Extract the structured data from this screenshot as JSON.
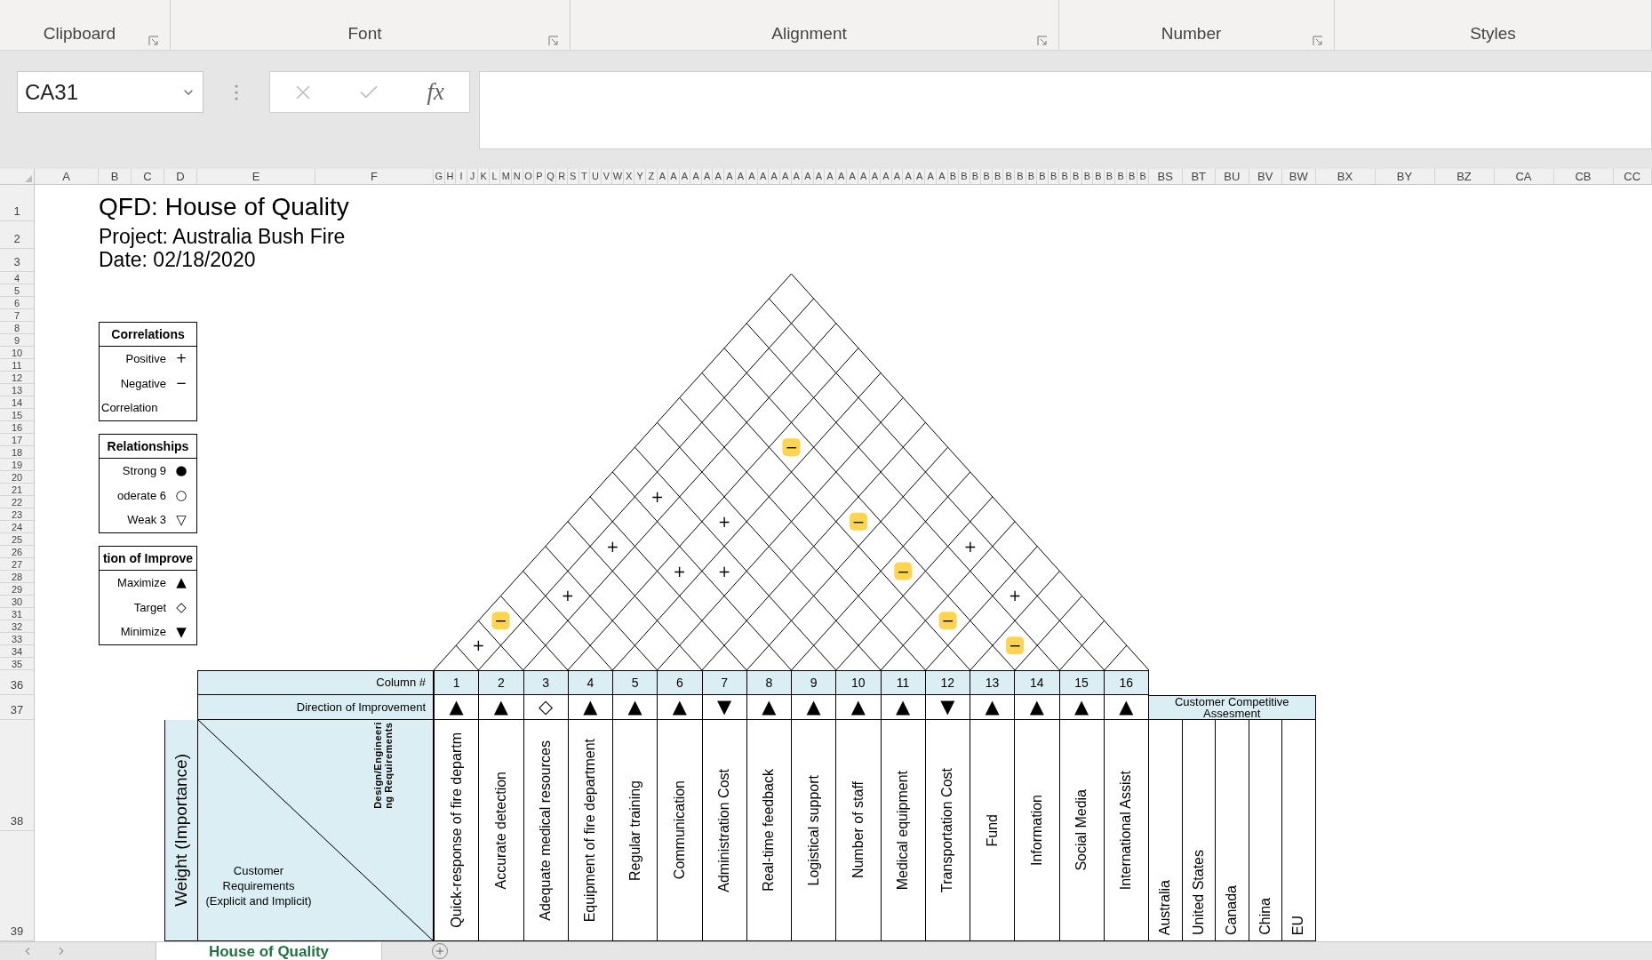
{
  "ribbon_groups": [
    {
      "label": "Clipboard",
      "launcher": true
    },
    {
      "label": "Font",
      "launcher": true
    },
    {
      "label": "Alignment",
      "launcher": true
    },
    {
      "label": "Number",
      "launcher": true
    },
    {
      "label": "Styles",
      "launcher": false
    }
  ],
  "formula_bar": {
    "name_box": "CA31",
    "function_label": "fx"
  },
  "column_headers": [
    {
      "label": "A",
      "kind": "first"
    },
    {
      "label": "B",
      "kind": "medium"
    },
    {
      "label": "C",
      "kind": "medium"
    },
    {
      "label": "D",
      "kind": "medium"
    },
    {
      "label": "E",
      "kind": "wide"
    },
    {
      "label": "F",
      "kind": "wide"
    },
    {
      "label": "G",
      "kind": "narrow"
    },
    {
      "label": "H",
      "kind": "narrow"
    },
    {
      "label": "I",
      "kind": "narrow"
    },
    {
      "label": "J",
      "kind": "narrow"
    },
    {
      "label": "K",
      "kind": "narrow"
    },
    {
      "label": "L",
      "kind": "narrow"
    },
    {
      "label": "M",
      "kind": "narrow"
    },
    {
      "label": "N",
      "kind": "narrow"
    },
    {
      "label": "O",
      "kind": "narrow"
    },
    {
      "label": "P",
      "kind": "narrow"
    },
    {
      "label": "Q",
      "kind": "narrow"
    },
    {
      "label": "R",
      "kind": "narrow"
    },
    {
      "label": "S",
      "kind": "narrow"
    },
    {
      "label": "T",
      "kind": "narrow"
    },
    {
      "label": "U",
      "kind": "narrow"
    },
    {
      "label": "V",
      "kind": "narrow"
    },
    {
      "label": "W",
      "kind": "narrow"
    },
    {
      "label": "X",
      "kind": "narrow"
    },
    {
      "label": "Y",
      "kind": "narrow"
    },
    {
      "label": "Z",
      "kind": "narrow"
    },
    {
      "label": "A",
      "kind": "narrow"
    },
    {
      "label": "A",
      "kind": "narrow"
    },
    {
      "label": "A",
      "kind": "narrow"
    },
    {
      "label": "A",
      "kind": "narrow"
    },
    {
      "label": "A",
      "kind": "narrow"
    },
    {
      "label": "A",
      "kind": "narrow"
    },
    {
      "label": "A",
      "kind": "narrow"
    },
    {
      "label": "A",
      "kind": "narrow"
    },
    {
      "label": "A",
      "kind": "narrow"
    },
    {
      "label": "A",
      "kind": "narrow"
    },
    {
      "label": "A",
      "kind": "narrow"
    },
    {
      "label": "A",
      "kind": "narrow"
    },
    {
      "label": "A",
      "kind": "narrow"
    },
    {
      "label": "A",
      "kind": "narrow"
    },
    {
      "label": "A",
      "kind": "narrow"
    },
    {
      "label": "A",
      "kind": "narrow"
    },
    {
      "label": "A",
      "kind": "narrow"
    },
    {
      "label": "A",
      "kind": "narrow"
    },
    {
      "label": "A",
      "kind": "narrow"
    },
    {
      "label": "A",
      "kind": "narrow"
    },
    {
      "label": "A",
      "kind": "narrow"
    },
    {
      "label": "A",
      "kind": "narrow"
    },
    {
      "label": "A",
      "kind": "narrow"
    },
    {
      "label": "A",
      "kind": "narrow"
    },
    {
      "label": "A",
      "kind": "narrow"
    },
    {
      "label": "A",
      "kind": "narrow"
    },
    {
      "label": "B",
      "kind": "narrow"
    },
    {
      "label": "B",
      "kind": "narrow"
    },
    {
      "label": "B",
      "kind": "narrow"
    },
    {
      "label": "B",
      "kind": "narrow"
    },
    {
      "label": "B",
      "kind": "narrow"
    },
    {
      "label": "B",
      "kind": "narrow"
    },
    {
      "label": "B",
      "kind": "narrow"
    },
    {
      "label": "B",
      "kind": "narrow"
    },
    {
      "label": "B",
      "kind": "narrow"
    },
    {
      "label": "B",
      "kind": "narrow"
    },
    {
      "label": "B",
      "kind": "narrow"
    },
    {
      "label": "B",
      "kind": "narrow"
    },
    {
      "label": "B",
      "kind": "narrow"
    },
    {
      "label": "B",
      "kind": "narrow"
    },
    {
      "label": "B",
      "kind": "narrow"
    },
    {
      "label": "B",
      "kind": "narrow"
    },
    {
      "label": "B",
      "kind": "narrow"
    },
    {
      "label": "B",
      "kind": "narrow"
    },
    {
      "label": "BS",
      "kind": "small"
    },
    {
      "label": "BT",
      "kind": "small"
    },
    {
      "label": "BU",
      "kind": "small"
    },
    {
      "label": "BV",
      "kind": "small"
    },
    {
      "label": "BW",
      "kind": "small"
    },
    {
      "label": "BX",
      "kind": "regular"
    },
    {
      "label": "BY",
      "kind": "regular"
    },
    {
      "label": "BZ",
      "kind": "regular"
    },
    {
      "label": "CA",
      "kind": "regular"
    },
    {
      "label": "CB",
      "kind": "regular"
    },
    {
      "label": "CC",
      "kind": "partial"
    }
  ],
  "row_headers": [
    {
      "label": "1",
      "kind": "title"
    },
    {
      "label": "2",
      "kind": "subtitle"
    },
    {
      "label": "3",
      "kind": "text"
    },
    {
      "label": "4",
      "kind": "thin"
    },
    {
      "label": "5",
      "kind": "thin"
    },
    {
      "label": "6",
      "kind": "thin"
    },
    {
      "label": "7",
      "kind": "thin"
    },
    {
      "label": "8",
      "kind": "thin"
    },
    {
      "label": "9",
      "kind": "thin"
    },
    {
      "label": "10",
      "kind": "thin"
    },
    {
      "label": "11",
      "kind": "thin"
    },
    {
      "label": "12",
      "kind": "thin"
    },
    {
      "label": "13",
      "kind": "thin"
    },
    {
      "label": "14",
      "kind": "thin"
    },
    {
      "label": "15",
      "kind": "thin"
    },
    {
      "label": "16",
      "kind": "thin"
    },
    {
      "label": "17",
      "kind": "thin"
    },
    {
      "label": "18",
      "kind": "thin"
    },
    {
      "label": "19",
      "kind": "thin"
    },
    {
      "label": "20",
      "kind": "thin"
    },
    {
      "label": "21",
      "kind": "thin"
    },
    {
      "label": "22",
      "kind": "thin"
    },
    {
      "label": "23",
      "kind": "thin"
    },
    {
      "label": "24",
      "kind": "thin"
    },
    {
      "label": "25",
      "kind": "thin"
    },
    {
      "label": "26",
      "kind": "thin"
    },
    {
      "label": "27",
      "kind": "thin"
    },
    {
      "label": "28",
      "kind": "thin"
    },
    {
      "label": "29",
      "kind": "thin"
    },
    {
      "label": "30",
      "kind": "thin"
    },
    {
      "label": "31",
      "kind": "thin"
    },
    {
      "label": "32",
      "kind": "thin"
    },
    {
      "label": "33",
      "kind": "thin"
    },
    {
      "label": "34",
      "kind": "thin"
    },
    {
      "label": "35",
      "kind": "thin"
    },
    {
      "label": "36",
      "kind": "header"
    },
    {
      "label": "37",
      "kind": "header"
    },
    {
      "label": "38",
      "kind": "tall"
    },
    {
      "label": "39",
      "kind": "tall"
    }
  ],
  "sheet": {
    "title": "QFD: House of Quality",
    "project": "Project: Australia Bush Fire",
    "date": "Date: 02/18/2020",
    "legends": [
      {
        "title": "Correlations",
        "items": [
          {
            "kind": "entry",
            "label": "Positive",
            "symbol": "+"
          },
          {
            "kind": "entry",
            "label": "Negative",
            "symbol": "−"
          },
          {
            "kind": "note",
            "label": "Correlation"
          }
        ]
      },
      {
        "title": "Relationships",
        "items": [
          {
            "kind": "entry",
            "label": "Strong 9",
            "symbol": "●"
          },
          {
            "kind": "entry",
            "label": "oderate 6",
            "symbol": "○"
          },
          {
            "kind": "entry",
            "label": "Weak 3",
            "symbol": "▽"
          }
        ]
      },
      {
        "title": "tion of Improve",
        "items": [
          {
            "kind": "entry",
            "label": "Maximize",
            "symbol": "▲"
          },
          {
            "kind": "entry",
            "label": "Target",
            "symbol": "◇"
          },
          {
            "kind": "entry",
            "label": "Minimize",
            "symbol": "▼"
          }
        ]
      }
    ],
    "hoq": {
      "column_label": "Column #",
      "direction_label": "Direction of Improvement",
      "weight_label": "Weight (Importance)",
      "design_label": [
        "Design/Engineeri",
        "ng Requirements"
      ],
      "customer_label": [
        "Customer",
        "Requirements",
        "(Explicit and Implicit)"
      ],
      "engineering": [
        {
          "number": "1",
          "direction": "▲",
          "requirement": "Quick-response of fire departm"
        },
        {
          "number": "2",
          "direction": "▲",
          "requirement": "Accurate detection"
        },
        {
          "number": "3",
          "direction": "◇",
          "requirement": "Adequate medical resources"
        },
        {
          "number": "4",
          "direction": "▲",
          "requirement": "Equipment of fire department"
        },
        {
          "number": "5",
          "direction": "▲",
          "requirement": "Regular training"
        },
        {
          "number": "6",
          "direction": "▲",
          "requirement": "Communication"
        },
        {
          "number": "7",
          "direction": "▼",
          "requirement": "Administration Cost"
        },
        {
          "number": "8",
          "direction": "▲",
          "requirement": "Real-time feedback"
        },
        {
          "number": "9",
          "direction": "▲",
          "requirement": "Logistical support"
        },
        {
          "number": "10",
          "direction": "▲",
          "requirement": "Number of staff"
        },
        {
          "number": "11",
          "direction": "▲",
          "requirement": "Medical equipment"
        },
        {
          "number": "12",
          "direction": "▼",
          "requirement": "Transportation Cost"
        },
        {
          "number": "13",
          "direction": "▲",
          "requirement": "Fund"
        },
        {
          "number": "14",
          "direction": "▲",
          "requirement": "Information"
        },
        {
          "number": "15",
          "direction": "▲",
          "requirement": "Social Media"
        },
        {
          "number": "16",
          "direction": "▲",
          "requirement": "International Assist"
        }
      ],
      "roof_rows": [
        [
          {}
        ],
        [
          {},
          {}
        ],
        [
          {},
          {},
          {}
        ],
        [
          {},
          {},
          {},
          {}
        ],
        [
          {},
          {},
          {},
          {},
          {}
        ],
        [
          {},
          {},
          {},
          {},
          {},
          {}
        ],
        [
          {},
          {},
          {},
          {
            "symbol": "−",
            "highlighted": true
          },
          {},
          {},
          {}
        ],
        [
          {},
          {},
          {},
          {},
          {},
          {},
          {},
          {}
        ],
        [
          {},
          {
            "symbol": "+",
            "highlighted": false
          },
          {},
          {},
          {},
          {},
          {},
          {},
          {}
        ],
        [
          {},
          {},
          {},
          {
            "symbol": "+",
            "highlighted": false
          },
          {},
          {},
          {
            "symbol": "−",
            "highlighted": true
          },
          {},
          {},
          {}
        ],
        [
          {},
          {
            "symbol": "+",
            "highlighted": false
          },
          {},
          {},
          {},
          {},
          {},
          {},
          {},
          {
            "symbol": "+",
            "highlighted": false
          },
          {}
        ],
        [
          {},
          {},
          {},
          {
            "symbol": "+",
            "highlighted": false
          },
          {
            "symbol": "+",
            "highlighted": false
          },
          {},
          {},
          {},
          {
            "symbol": "−",
            "highlighted": true
          },
          {},
          {},
          {}
        ],
        [
          {},
          {
            "symbol": "+",
            "highlighted": false
          },
          {},
          {},
          {},
          {},
          {},
          {},
          {},
          {},
          {},
          {
            "symbol": "+",
            "highlighted": false
          },
          {}
        ],
        [
          {
            "symbol": "−",
            "highlighted": true
          },
          {},
          {},
          {},
          {},
          {},
          {},
          {},
          {},
          {},
          {
            "symbol": "−",
            "highlighted": true
          },
          {},
          {},
          {}
        ],
        [
          {
            "symbol": "+",
            "highlighted": false
          },
          {},
          {},
          {},
          {},
          {},
          {},
          {},
          {},
          {},
          {},
          {},
          {
            "symbol": "−",
            "highlighted": true
          },
          {},
          {}
        ]
      ],
      "competitive": {
        "title": "Customer Competitive Assesment",
        "competitors": [
          "Australia",
          "United States",
          "Canada",
          "China",
          "EU"
        ]
      }
    }
  },
  "sheet_tabs": [
    {
      "label": "House of Quality",
      "selected": true
    }
  ]
}
